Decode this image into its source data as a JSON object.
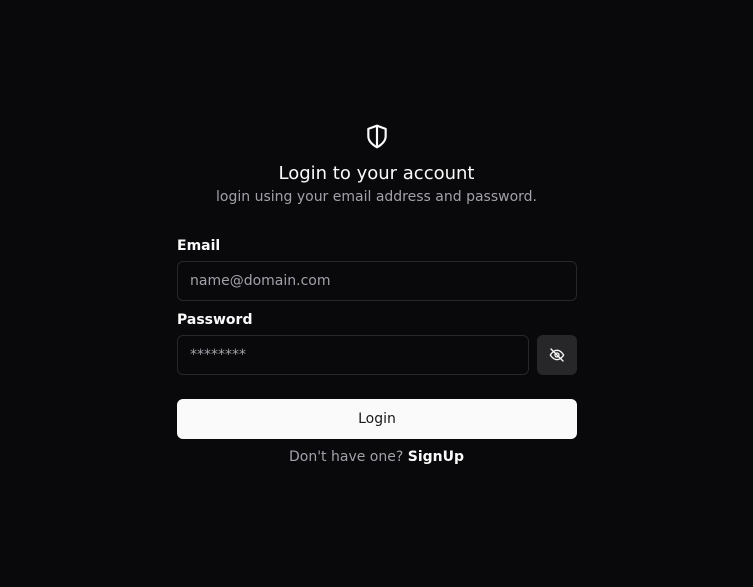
{
  "header": {
    "icon": "shield-icon",
    "title": "Login to your account",
    "subtitle": "login using your email address and password."
  },
  "form": {
    "email_label": "Email",
    "email_placeholder": "name@domain.com",
    "email_value": "",
    "password_label": "Password",
    "password_placeholder": "********",
    "password_value": "",
    "toggle_visibility_icon": "eye-off-icon",
    "submit_label": "Login"
  },
  "footer": {
    "prompt": "Don't have one?",
    "signup_link": "SignUp"
  },
  "colors": {
    "background": "#09090b",
    "foreground": "#fafafa",
    "muted": "#a1a1aa",
    "border": "#27272a",
    "primary_button": "#fafafa"
  }
}
